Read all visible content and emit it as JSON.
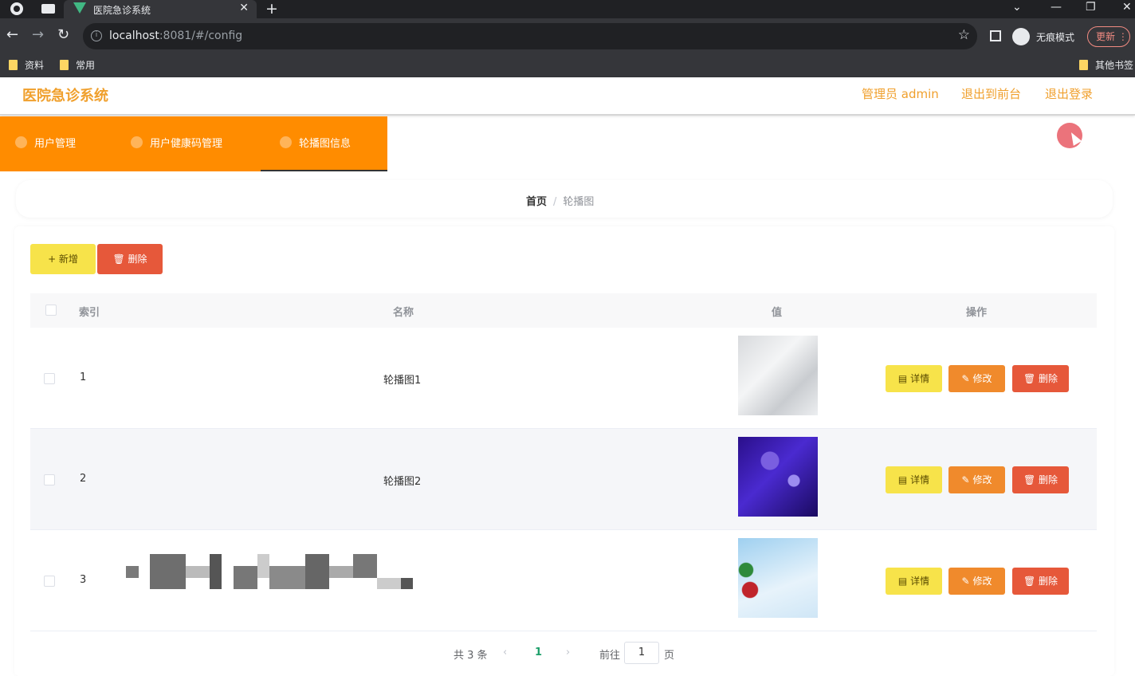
{
  "browser": {
    "tab_title": "医院急诊系统",
    "url_host": "localhost",
    "url_path": ":8081/#/config",
    "incognito_label": "无痕模式",
    "update_label": "更新",
    "bookmarks": [
      "资料",
      "常用"
    ],
    "other_bookmarks": "其他书签"
  },
  "header": {
    "title": "医院急诊系统",
    "admin_label": "管理员 admin",
    "back_front_label": "退出到前台",
    "logout_label": "退出登录"
  },
  "menu": {
    "items": [
      {
        "label": "用户管理",
        "icon": "user-icon"
      },
      {
        "label": "用户健康码管理",
        "icon": "qrcode-icon"
      },
      {
        "label": "轮播图信息",
        "icon": "image-icon"
      }
    ],
    "active_index": 2
  },
  "breadcrumb": {
    "home": "首页",
    "separator": "/",
    "current": "轮播图"
  },
  "toolbar": {
    "add_label": "+ 新增",
    "delete_label": "删除"
  },
  "table": {
    "columns": [
      "索引",
      "名称",
      "值",
      "操作"
    ],
    "rows": [
      {
        "index": "1",
        "name": "轮播图1",
        "image_desc": "light-grey-texture"
      },
      {
        "index": "2",
        "name": "轮播图2",
        "image_desc": "purple-bokeh"
      },
      {
        "index": "3",
        "name": "",
        "image_desc": "sky-blue-flowers"
      }
    ],
    "actions": {
      "detail_label": "详情",
      "edit_label": "修改",
      "delete_label": "删除"
    }
  },
  "pagination": {
    "total_label": "共 3 条",
    "current_page": "1",
    "goto_label": "前往",
    "page_input": "1",
    "page_suffix": "页"
  },
  "colors": {
    "accent": "#ff8c00",
    "title_color": "#f0a02d",
    "add_btn": "#f7e34a",
    "edit_btn": "#f08a2c",
    "delete_btn": "#e6583a"
  }
}
